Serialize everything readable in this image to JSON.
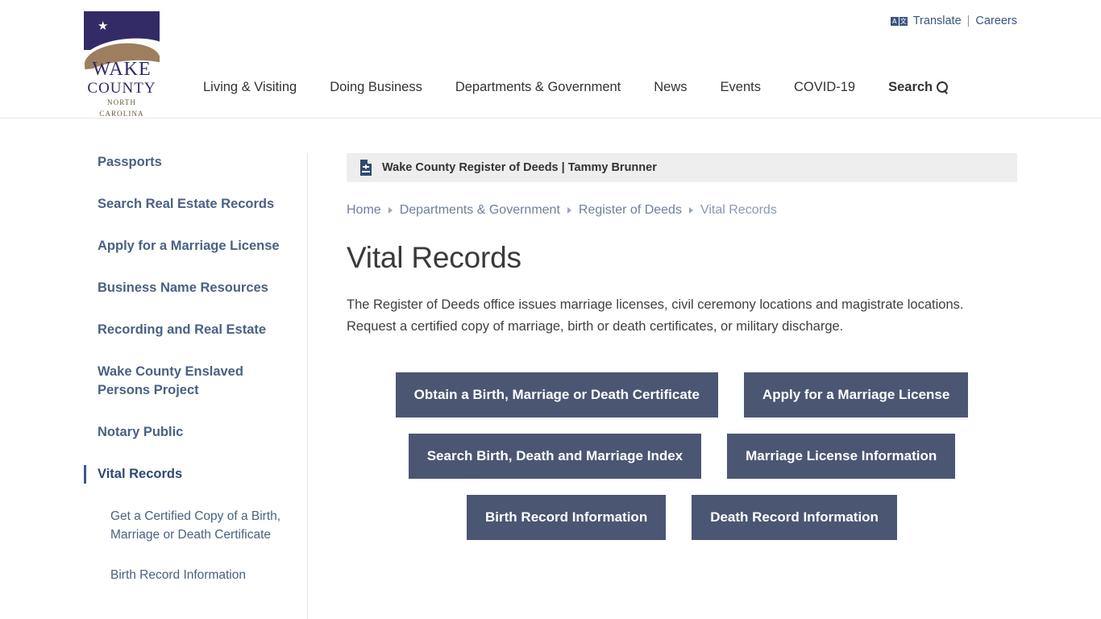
{
  "site": {
    "logo": {
      "star": "★",
      "wake": "WAKE",
      "county": "COUNTY",
      "state": "NORTH CAROLINA"
    },
    "colors": {
      "logo_navy": "#332b66",
      "logo_tan": "#9d7f5f",
      "button": "#4b5672",
      "sidebar_link": "#4a6184",
      "banner_gray": "#eeeeee"
    }
  },
  "utility_nav": {
    "translate_icon": "translate-icon",
    "translate_glyph_a": "A",
    "translate_glyph_cjk": "文",
    "translate_label": "Translate",
    "separator": "|",
    "careers_label": "Careers"
  },
  "main_nav": {
    "items": [
      {
        "label": "Living & Visiting"
      },
      {
        "label": "Doing Business"
      },
      {
        "label": "Departments & Government"
      },
      {
        "label": "News"
      },
      {
        "label": "Events"
      },
      {
        "label": "COVID-19"
      }
    ],
    "search_label": "Search"
  },
  "sidebar": {
    "items": [
      {
        "label": "Passports",
        "active": false
      },
      {
        "label": "Search Real Estate Records",
        "active": false
      },
      {
        "label": "Apply for a Marriage License",
        "active": false
      },
      {
        "label": "Business Name Resources",
        "active": false
      },
      {
        "label": "Recording and Real Estate",
        "active": false
      },
      {
        "label": "Wake County Enslaved Persons Project",
        "active": false
      },
      {
        "label": "Notary Public",
        "active": false
      },
      {
        "label": "Vital Records",
        "active": true
      }
    ],
    "sub_items": [
      {
        "label": "Get a Certified Copy of a Birth, Marriage or Death Certificate"
      },
      {
        "label": "Birth Record Information"
      }
    ]
  },
  "content": {
    "department_banner": {
      "icon": "document-icon",
      "text": "Wake County Register of Deeds | Tammy Brunner"
    },
    "breadcrumb": [
      {
        "label": "Home",
        "current": false
      },
      {
        "label": "Departments & Government",
        "current": false
      },
      {
        "label": "Register of Deeds",
        "current": false
      },
      {
        "label": "Vital Records",
        "current": true
      }
    ],
    "title": "Vital Records",
    "intro": "The Register of Deeds office issues marriage licenses, civil ceremony locations and magistrate locations. Request a certified copy of marriage, birth or death certificates, or military discharge.",
    "buttons": [
      [
        {
          "label": "Obtain a Birth, Marriage or Death Certificate"
        },
        {
          "label": "Apply for a Marriage License"
        }
      ],
      [
        {
          "label": "Search Birth, Death and Marriage Index"
        },
        {
          "label": "Marriage License Information"
        }
      ],
      [
        {
          "label": "Birth Record Information"
        },
        {
          "label": "Death Record Information"
        }
      ]
    ]
  }
}
